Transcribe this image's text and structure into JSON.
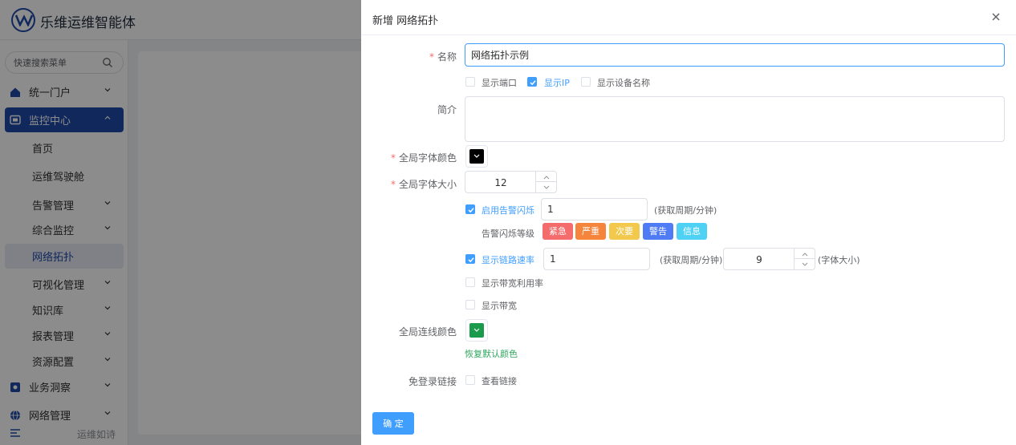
{
  "app": {
    "title": "乐维运维智能体",
    "search_placeholder": "快速搜索菜单",
    "menu": [
      {
        "label": "统一门户",
        "icon": "home-icon"
      },
      {
        "label": "监控中心",
        "icon": "monitor-icon"
      },
      {
        "label": "首页"
      },
      {
        "label": "运维驾驶舱"
      },
      {
        "label": "告警管理"
      },
      {
        "label": "综合监控"
      },
      {
        "label": "网络拓扑"
      },
      {
        "label": "可视化管理"
      },
      {
        "label": "知识库"
      },
      {
        "label": "报表管理"
      },
      {
        "label": "资源配置"
      },
      {
        "label": "业务洞察",
        "icon": "insight-icon"
      },
      {
        "label": "网络管理",
        "icon": "globe-icon"
      }
    ],
    "footer_text": "运维如诗"
  },
  "drawer": {
    "title": "新增 网络拓扑",
    "close_icon": "close-icon",
    "form": {
      "name_label": "名称",
      "name_value": "网络拓扑示例",
      "show_port": "显示端口",
      "show_ip": "显示IP",
      "show_device_name": "显示设备名称",
      "intro_label": "简介",
      "intro_value": "",
      "font_color_label": "全局字体颜色",
      "font_color": "#000000",
      "font_size_label": "全局字体大小",
      "font_size": "12",
      "alarm_flash_label": "启用告警闪烁",
      "alarm_flash_value": "1",
      "period_unit": "(获取周期/分钟)",
      "alarm_level_label": "告警闪烁等级",
      "alarm_levels": [
        {
          "label": "紧急",
          "color": "#f56c6c"
        },
        {
          "label": "严重",
          "color": "#f5843c"
        },
        {
          "label": "次要",
          "color": "#f2c94c"
        },
        {
          "label": "警告",
          "color": "#4f7cf5"
        },
        {
          "label": "信息",
          "color": "#4fd1f5"
        }
      ],
      "link_rate_label": "显示链路速率",
      "link_rate_value": "1",
      "link_rate_font_size": "9",
      "font_size_unit": "(字体大小)",
      "bandwidth_util_label": "显示带宽利用率",
      "bandwidth_label": "显示带宽",
      "line_color_label": "全局连线颜色",
      "line_color": "#1a9b4b",
      "restore_default": "恢复默认颜色",
      "nologin_label": "免登录链接",
      "view_link": "查看链接",
      "confirm": "确 定"
    }
  }
}
